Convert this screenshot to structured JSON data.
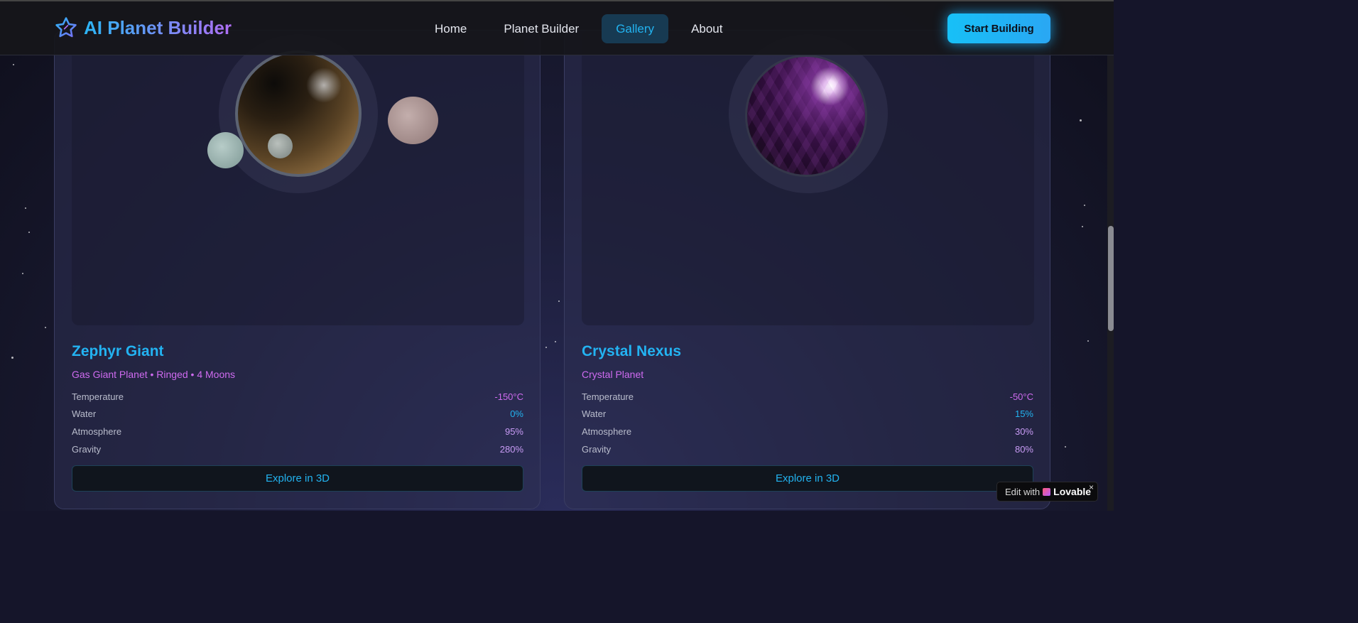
{
  "nav": {
    "brand": "AI Planet Builder",
    "links": [
      {
        "label": "Home"
      },
      {
        "label": "Planet Builder"
      },
      {
        "label": "Gallery",
        "active": true
      },
      {
        "label": "About"
      }
    ],
    "cta": "Start Building"
  },
  "gallery": {
    "cards": [
      {
        "title": "Zephyr Giant",
        "subtitle": "Gas Giant Planet • Ringed • 4 Moons",
        "stats": [
          {
            "label": "Temperature",
            "value": "-150°C"
          },
          {
            "label": "Water",
            "value": "0%"
          },
          {
            "label": "Atmosphere",
            "value": "95%"
          },
          {
            "label": "Gravity",
            "value": "280%"
          }
        ],
        "button": "Explore in 3D"
      },
      {
        "title": "Crystal Nexus",
        "subtitle": "Crystal Planet",
        "stats": [
          {
            "label": "Temperature",
            "value": "-50°C"
          },
          {
            "label": "Water",
            "value": "15%"
          },
          {
            "label": "Atmosphere",
            "value": "30%"
          },
          {
            "label": "Gravity",
            "value": "80%"
          }
        ],
        "button": "Explore in 3D"
      }
    ]
  },
  "badge": {
    "prefix": "Edit with",
    "name": "Lovable",
    "close": "×"
  },
  "colors": {
    "accent_cyan": "#22b3f0",
    "accent_pink": "#cf6bf0",
    "accent_violet": "#c89bf5",
    "background": "#15152a"
  },
  "icons": {
    "brand": "star-icon",
    "badge": "heart-icon"
  }
}
